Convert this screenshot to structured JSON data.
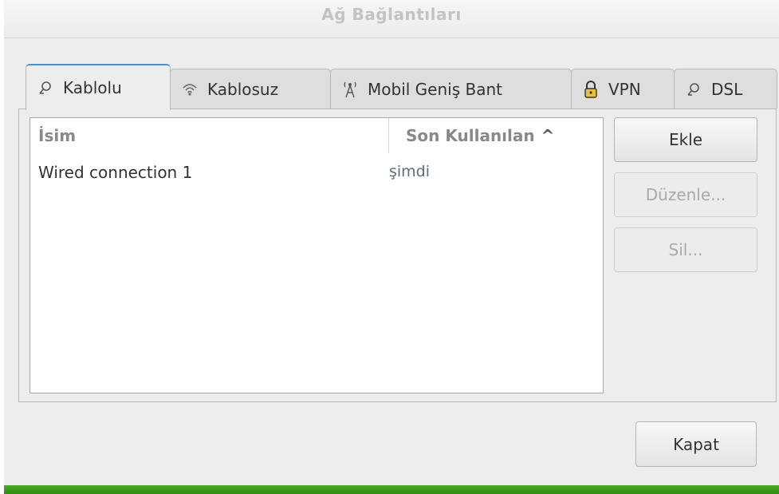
{
  "window": {
    "title": "Ağ Bağlantıları"
  },
  "tabs": [
    {
      "label": "Kablolu",
      "icon": "wired-icon",
      "active": true
    },
    {
      "label": "Kablosuz",
      "icon": "wireless-icon",
      "active": false
    },
    {
      "label": "Mobil Geniş Bant",
      "icon": "antenna-icon",
      "active": false
    },
    {
      "label": "VPN",
      "icon": "lock-icon",
      "active": false
    },
    {
      "label": "DSL",
      "icon": "wired-icon",
      "active": false
    }
  ],
  "list": {
    "columns": {
      "name": "İsim",
      "last_used": "Son Kullanılan",
      "sort_indicator": "^"
    },
    "rows": [
      {
        "name": "Wired connection 1",
        "last_used": "şimdi"
      }
    ]
  },
  "buttons": {
    "add": "Ekle",
    "edit": "Düzenle...",
    "delete": "Sil...",
    "close": "Kapat"
  },
  "colors": {
    "accent": "#4a90d9",
    "bottom_bar": "#3a9a18"
  }
}
